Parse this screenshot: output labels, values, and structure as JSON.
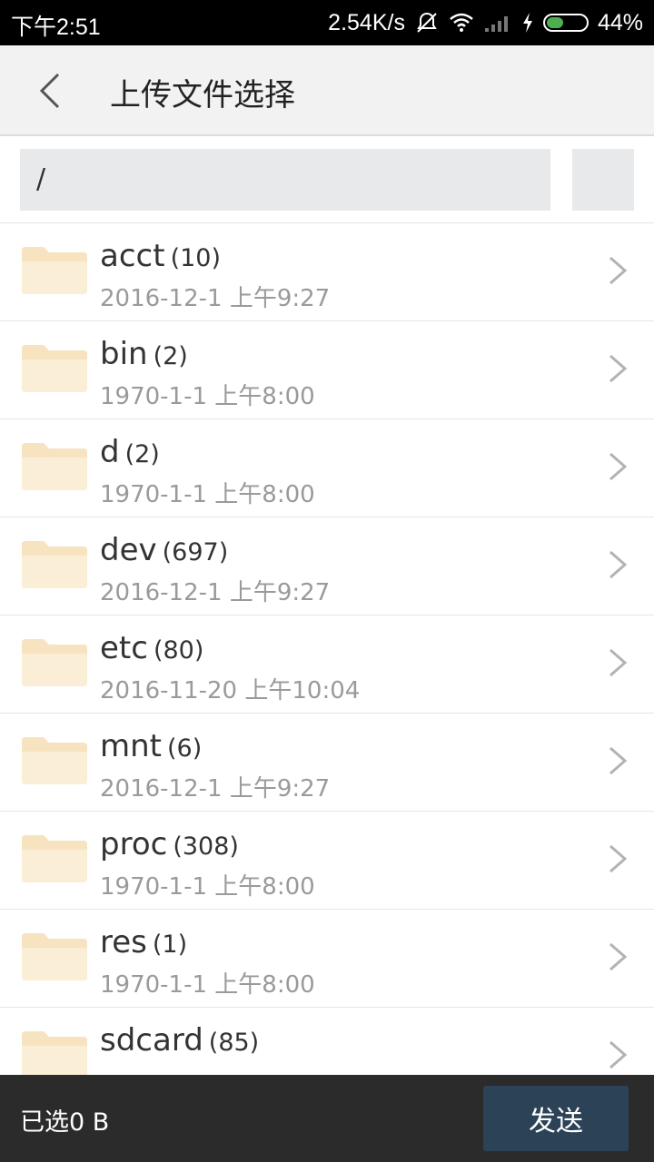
{
  "status_bar": {
    "time": "下午2:51",
    "speed": "2.54K/s",
    "battery_percent": "44%",
    "battery_level": 0.44,
    "icons": [
      "muted-alarm-icon",
      "wifi-icon",
      "signal-icon",
      "charging-icon",
      "battery-icon"
    ]
  },
  "header": {
    "title": "上传文件选择",
    "back_icon": "chevron-left-icon"
  },
  "path": {
    "value": "/"
  },
  "folders": [
    {
      "name": "acct",
      "count": "(10)",
      "date": "2016-12-1 上午9:27"
    },
    {
      "name": "bin",
      "count": "(2)",
      "date": "1970-1-1 上午8:00"
    },
    {
      "name": "d",
      "count": "(2)",
      "date": "1970-1-1 上午8:00"
    },
    {
      "name": "dev",
      "count": "(697)",
      "date": "2016-12-1 上午9:27"
    },
    {
      "name": "etc",
      "count": "(80)",
      "date": "2016-11-20 上午10:04"
    },
    {
      "name": "mnt",
      "count": "(6)",
      "date": "2016-12-1 上午9:27"
    },
    {
      "name": "proc",
      "count": "(308)",
      "date": "1970-1-1 上午8:00"
    },
    {
      "name": "res",
      "count": "(1)",
      "date": "1970-1-1 上午8:00"
    },
    {
      "name": "sdcard",
      "count": "(85)",
      "date": ""
    }
  ],
  "bottom": {
    "selected": "已选0 B",
    "send_label": "发送"
  },
  "colors": {
    "folder": "#f7e3c0",
    "send_button": "#2c4257",
    "bottom_bar": "#2b2b2b"
  }
}
